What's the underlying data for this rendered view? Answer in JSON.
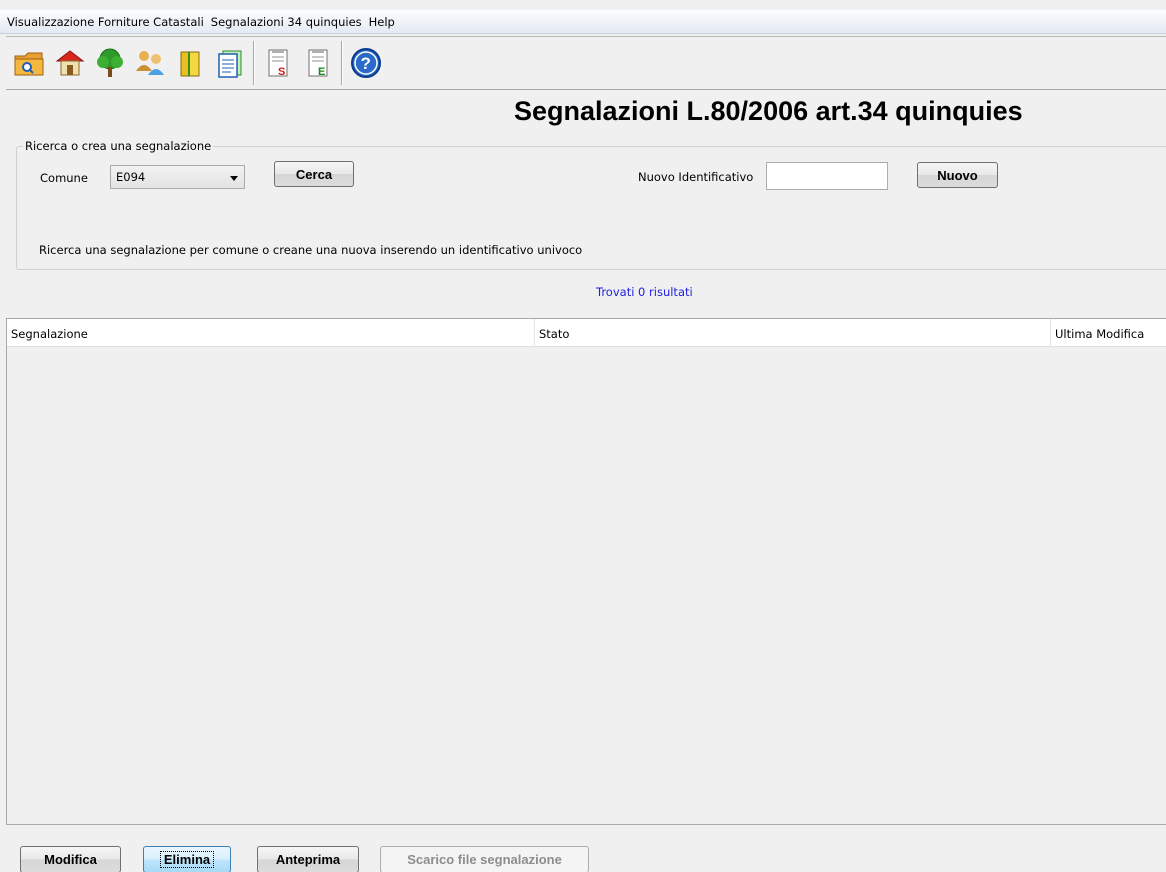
{
  "menu": [
    "Visualizzazione Forniture Catastali",
    "Segnalazioni 34 quinquies",
    "Help"
  ],
  "toolbar": {
    "group1": [
      "folder-search-icon",
      "house-icon",
      "tree-icon",
      "users-icon",
      "books-icon",
      "document-list-icon"
    ],
    "group2": [
      "document-s-icon",
      "document-e-icon"
    ],
    "group3": [
      "help-icon"
    ]
  },
  "page": {
    "title": "Segnalazioni L.80/2006 art.34 quinquies"
  },
  "search": {
    "group_title": "Ricerca o crea una segnalazione",
    "comune_label": "Comune",
    "comune_value": "E094",
    "search_button": "Cerca",
    "new_id_label": "Nuovo Identificativo",
    "new_id_value": "",
    "new_button": "Nuovo",
    "hint": "Ricerca una segnalazione per comune o creane una nuova inserendo un identificativo univoco"
  },
  "results": {
    "text": "Trovati 0 risultati"
  },
  "table": {
    "columns": [
      "Segnalazione",
      "Stato",
      "Ultima Modifica"
    ],
    "rows": []
  },
  "actions": {
    "modify": "Modifica",
    "delete": "Elimina",
    "preview": "Anteprima",
    "download": "Scarico file segnalazione"
  },
  "colors": {
    "results_text": "#2020e0",
    "background": "#f0f0f0",
    "accent_blue": "#1f5fb4"
  }
}
